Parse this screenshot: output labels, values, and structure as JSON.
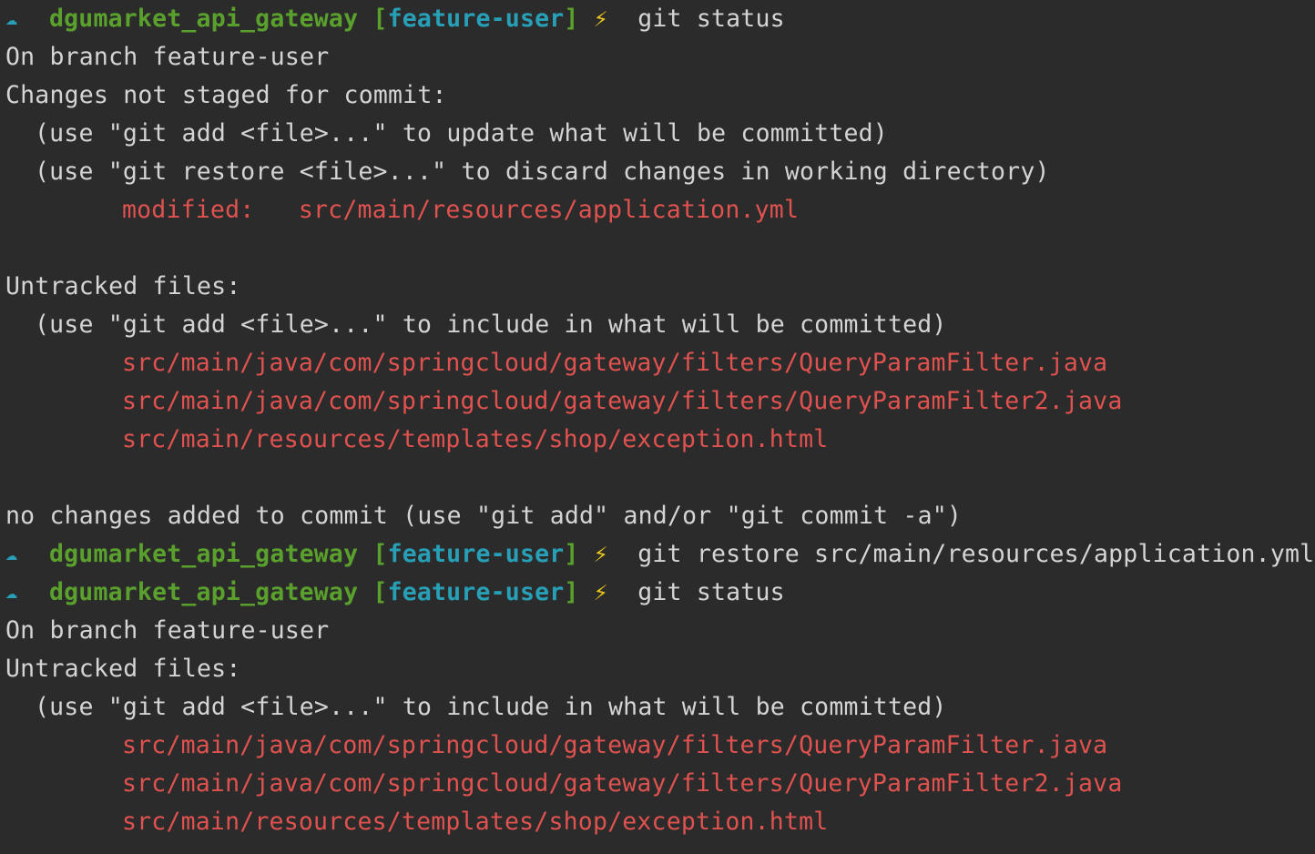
{
  "prompt": {
    "arrow": "☁",
    "repo": "dgumarket_api_gateway",
    "branch_open": "[",
    "branch": "feature-user",
    "branch_close": "]",
    "bolt": "⚡"
  },
  "commands": {
    "cmd1": "git status",
    "cmd2": "git restore src/main/resources/application.yml",
    "cmd3": "git status"
  },
  "output1": {
    "on_branch": "On branch feature-user",
    "not_staged_header": "Changes not staged for commit:",
    "hint_add_update": "(use \"git add <file>...\" to update what will be committed)",
    "hint_restore": "(use \"git restore <file>...\" to discard changes in working directory)",
    "modified_label": "modified:   ",
    "modified_file": "src/main/resources/application.yml",
    "untracked_header": "Untracked files:",
    "hint_add_include": "(use \"git add <file>...\" to include in what will be committed)",
    "untracked": [
      "src/main/java/com/springcloud/gateway/filters/QueryParamFilter.java",
      "src/main/java/com/springcloud/gateway/filters/QueryParamFilter2.java",
      "src/main/resources/templates/shop/exception.html"
    ],
    "no_changes": "no changes added to commit (use \"git add\" and/or \"git commit -a\")"
  },
  "output2": {
    "on_branch": "On branch feature-user",
    "untracked_header": "Untracked files:",
    "hint_add_include": "(use \"git add <file>...\" to include in what will be committed)",
    "untracked": [
      "src/main/java/com/springcloud/gateway/filters/QueryParamFilter.java",
      "src/main/java/com/springcloud/gateway/filters/QueryParamFilter2.java",
      "src/main/resources/templates/shop/exception.html"
    ]
  },
  "colors": {
    "background": "#2b2b2b",
    "text": "#d4d4d4",
    "repo_green": "#5aa02c",
    "branch_cyan": "#27a0b7",
    "bolt_yellow": "#e9c41d",
    "file_red": "#e0524f"
  }
}
